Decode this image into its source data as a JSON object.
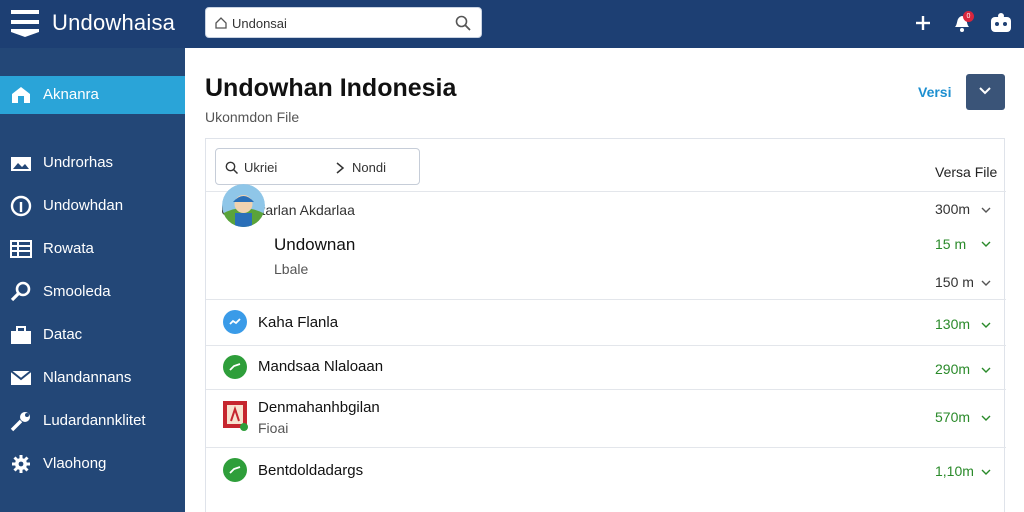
{
  "app": {
    "title": "Undowhaisa"
  },
  "search": {
    "value": "Undonsai"
  },
  "topbar_icons": [
    "plus-icon",
    "notification-icon",
    "profile-icon"
  ],
  "notification_count": "0",
  "sidebar": {
    "items": [
      {
        "label": "Aknanra",
        "icon": "home-icon",
        "active": true
      },
      {
        "label": "Undrorhas",
        "icon": "image-icon",
        "active": false
      },
      {
        "label": "Undowhdan",
        "icon": "info-icon",
        "active": false
      },
      {
        "label": "Rowata",
        "icon": "table-icon",
        "active": false
      },
      {
        "label": "Smooleda",
        "icon": "search-icon",
        "active": false
      },
      {
        "label": "Datac",
        "icon": "briefcase-icon",
        "active": false
      },
      {
        "label": "Nlandannans",
        "icon": "mail-icon",
        "active": false
      },
      {
        "label": "Ludardannklitet",
        "icon": "wrench-icon",
        "active": false
      },
      {
        "label": "Vlaohong",
        "icon": "gear-icon",
        "active": false
      }
    ]
  },
  "main": {
    "title": "Undowhan Indonesia",
    "subtitle": "Ukonmdon File",
    "versi_link": "Versi",
    "filter": {
      "text1": "Ukriei",
      "text2": "Nondi"
    },
    "column_label": "Versa File",
    "header_row": {
      "label": "Ukobatarlan Akdarlaa",
      "value": "300m"
    },
    "rows": [
      {
        "title": "Undownan",
        "subtitle": "Lbale",
        "value": "15 m",
        "value2": "150 m",
        "icon": "avatar"
      },
      {
        "title": "Kaha Flanla",
        "value": "130m",
        "icon": "blue-status-icon"
      },
      {
        "title": "Mandsaa Nlaloaan",
        "value": "290m",
        "icon": "green-status-icon"
      },
      {
        "title": "Denmahanhbgilan",
        "subtitle": "Fioai",
        "value": "570m",
        "icon": "file-thumb-icon"
      },
      {
        "title": "Bentdoldadargs",
        "value": "1,10m",
        "icon": "green-status-icon"
      }
    ]
  },
  "colors": {
    "topbar": "#1d3f73",
    "sidebar": "#234777",
    "active": "#2aa4d8",
    "green": "#2a8a2a",
    "link": "#1d8fd0"
  }
}
